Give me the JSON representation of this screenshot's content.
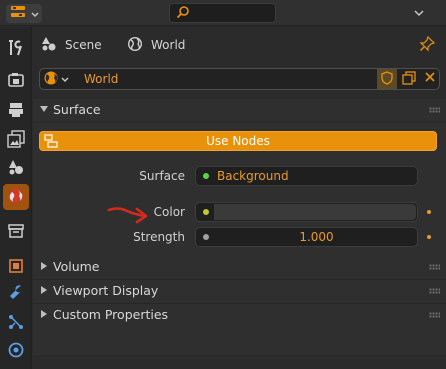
{
  "header": {
    "editor_type_icon": "properties-editor-icon",
    "search_icon": "search-icon",
    "menu_icon": "chevron-down-icon"
  },
  "tabs": [
    {
      "name": "tool",
      "icon": "wrench-screwdriver-icon"
    },
    {
      "name": "render",
      "icon": "render-camera-back-icon"
    },
    {
      "name": "output",
      "icon": "printer-icon"
    },
    {
      "name": "view-layer",
      "icon": "image-stack-icon"
    },
    {
      "name": "scene",
      "icon": "scene-cone-sphere-icon"
    },
    {
      "name": "world",
      "icon": "world-globe-icon",
      "active": true
    },
    {
      "name": "collection",
      "icon": "collection-box-icon"
    },
    {
      "name": "object",
      "icon": "object-square-icon"
    },
    {
      "name": "modifiers",
      "icon": "wrench-blue-icon"
    },
    {
      "name": "particles",
      "icon": "particles-icon"
    },
    {
      "name": "physics",
      "icon": "physics-orbit-icon"
    }
  ],
  "context": {
    "scene_label": "Scene",
    "world_label": "World"
  },
  "world_selector": {
    "name": "World"
  },
  "panels": {
    "surface": {
      "title": "Surface",
      "use_nodes_label": "Use Nodes",
      "surface_label": "Surface",
      "surface_value": "Background",
      "color_label": "Color",
      "strength_label": "Strength",
      "strength_value": "1.000"
    },
    "volume": {
      "title": "Volume"
    },
    "viewport_display": {
      "title": "Viewport Display"
    },
    "custom_properties": {
      "title": "Custom Properties"
    }
  },
  "colors": {
    "accent": "#e8920c",
    "accent_text": "#e99a2c",
    "active_tab": "#a0520f",
    "annotation_arrow": "#d42a1e",
    "surface_socket": "#5fd14c",
    "color_socket": "#c7c72a",
    "strength_socket": "#a1a1a1"
  }
}
